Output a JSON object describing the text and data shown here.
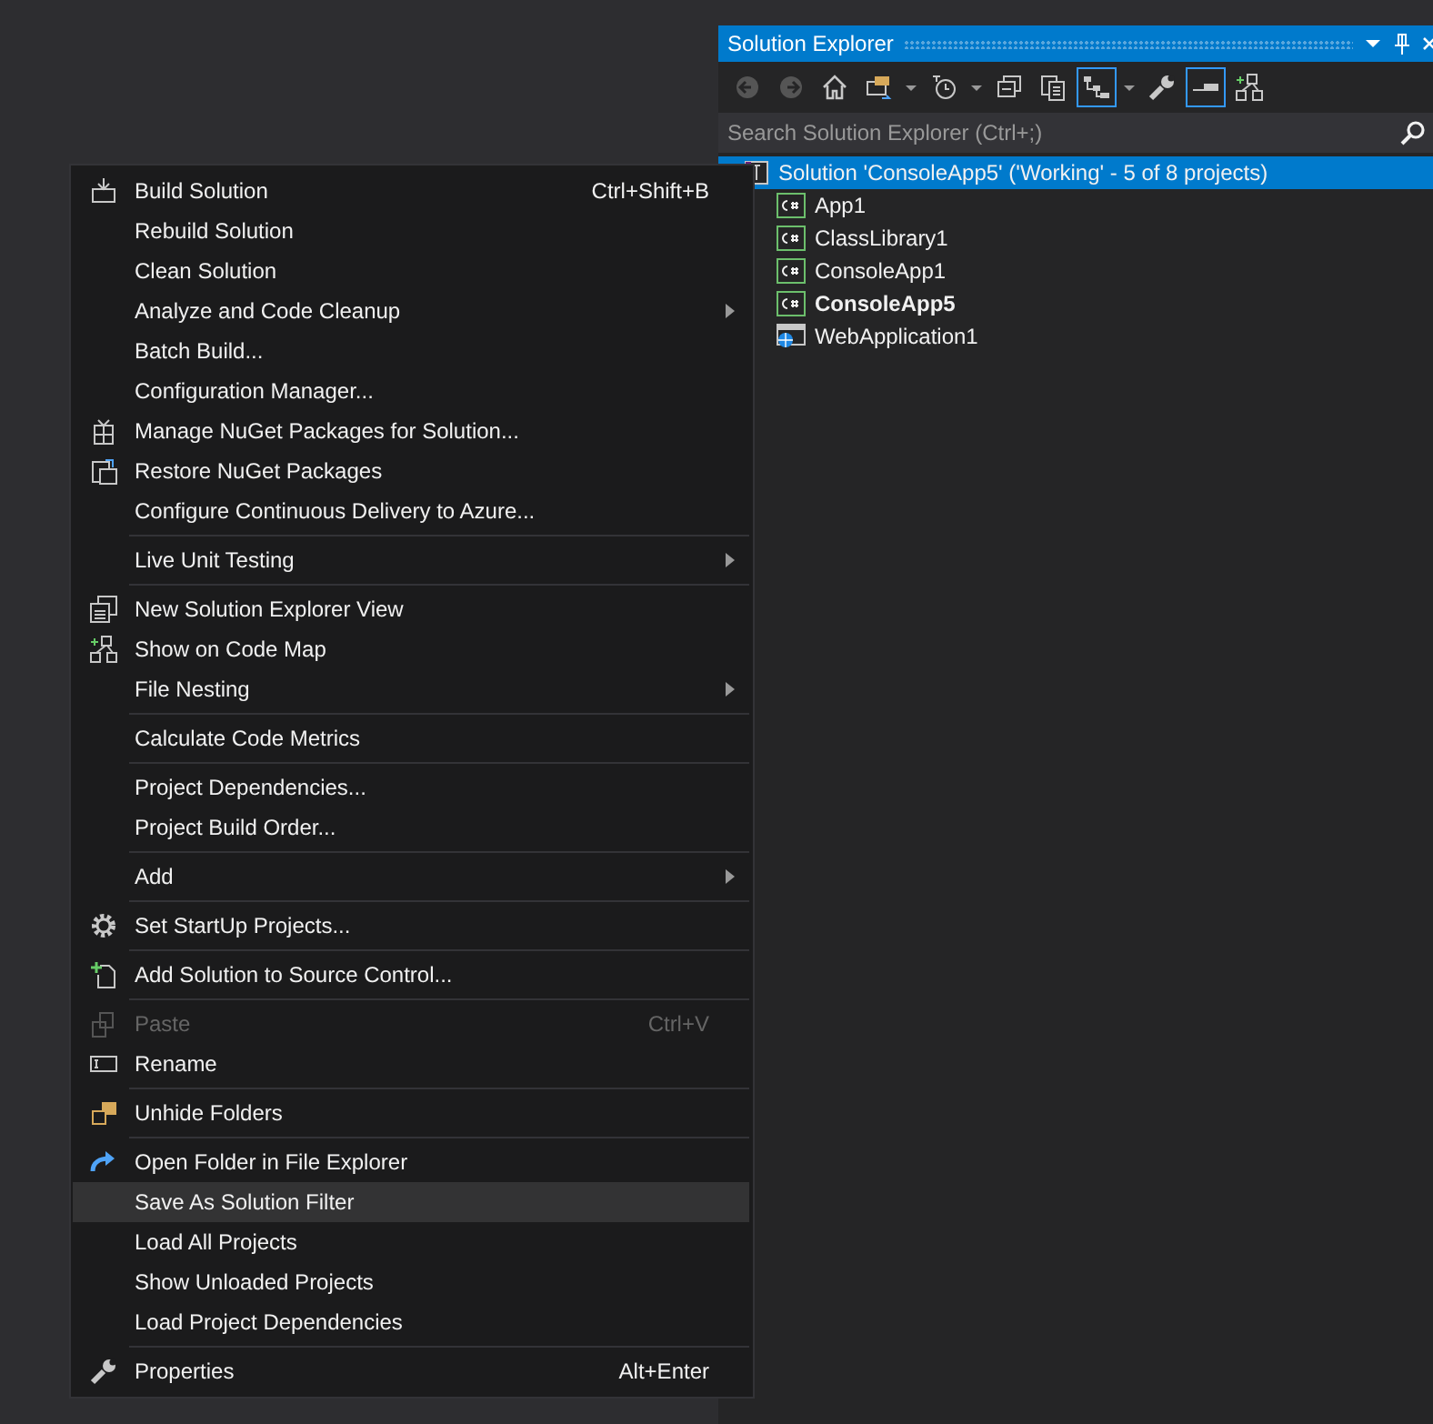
{
  "solution_explorer": {
    "title": "Solution Explorer",
    "toolbar": [
      {
        "kind": "back",
        "disabled": true,
        "active": false
      },
      {
        "kind": "forward",
        "disabled": true,
        "active": false
      },
      {
        "kind": "home",
        "disabled": false,
        "active": false
      },
      {
        "kind": "switch",
        "disabled": false,
        "active": false
      },
      {
        "kind": "dropdown",
        "disabled": false,
        "active": false
      },
      {
        "kind": "history",
        "disabled": false,
        "active": false
      },
      {
        "kind": "dropdown",
        "disabled": false,
        "active": false
      },
      {
        "kind": "collapse",
        "disabled": false,
        "active": false
      },
      {
        "kind": "copy",
        "disabled": false,
        "active": false
      },
      {
        "kind": "sync",
        "disabled": false,
        "active": true
      },
      {
        "kind": "dropdown",
        "disabled": false,
        "active": false
      },
      {
        "kind": "properties",
        "disabled": false,
        "active": false
      },
      {
        "kind": "preview",
        "disabled": false,
        "active": true
      },
      {
        "kind": "codemap",
        "disabled": false,
        "active": false
      }
    ],
    "search": {
      "placeholder": "Search Solution Explorer (Ctrl+;)"
    },
    "tree": [
      {
        "label": "Solution 'ConsoleApp5' ('Working' - 5 of 8 projects)",
        "kind": "solution",
        "selected": true,
        "bold": false,
        "children": [
          {
            "label": "App1",
            "kind": "csharp",
            "selected": false,
            "bold": false
          },
          {
            "label": "ClassLibrary1",
            "kind": "csharp",
            "selected": false,
            "bold": false
          },
          {
            "label": "ConsoleApp1",
            "kind": "csharp",
            "selected": false,
            "bold": false
          },
          {
            "label": "ConsoleApp5",
            "kind": "csharp",
            "selected": false,
            "bold": true
          },
          {
            "label": "WebApplication1",
            "kind": "web",
            "selected": false,
            "bold": false
          }
        ]
      }
    ]
  },
  "context_menu": {
    "groups": [
      [
        {
          "label": "Build Solution",
          "shortcut": "Ctrl+Shift+B",
          "submenu": false,
          "disabled": false,
          "highlighted": false
        },
        {
          "label": "Rebuild Solution",
          "submenu": false,
          "disabled": false,
          "highlighted": false
        },
        {
          "label": "Clean Solution",
          "submenu": false,
          "disabled": false,
          "highlighted": false
        },
        {
          "label": "Analyze and Code Cleanup",
          "submenu": true,
          "disabled": false,
          "highlighted": false
        },
        {
          "label": "Batch Build...",
          "submenu": false,
          "disabled": false,
          "highlighted": false
        },
        {
          "label": "Configuration Manager...",
          "submenu": false,
          "disabled": false,
          "highlighted": false
        },
        {
          "label": "Manage NuGet Packages for Solution...",
          "submenu": false,
          "disabled": false,
          "highlighted": false
        },
        {
          "label": "Restore NuGet Packages",
          "submenu": false,
          "disabled": false,
          "highlighted": false
        },
        {
          "label": "Configure Continuous Delivery to Azure...",
          "submenu": false,
          "disabled": false,
          "highlighted": false
        }
      ],
      [
        {
          "label": "Live Unit Testing",
          "submenu": true,
          "disabled": false,
          "highlighted": false
        }
      ],
      [
        {
          "label": "New Solution Explorer View",
          "submenu": false,
          "disabled": false,
          "highlighted": false
        },
        {
          "label": "Show on Code Map",
          "submenu": false,
          "disabled": false,
          "highlighted": false
        },
        {
          "label": "File Nesting",
          "submenu": true,
          "disabled": false,
          "highlighted": false
        }
      ],
      [
        {
          "label": "Calculate Code Metrics",
          "submenu": false,
          "disabled": false,
          "highlighted": false
        }
      ],
      [
        {
          "label": "Project Dependencies...",
          "submenu": false,
          "disabled": false,
          "highlighted": false
        },
        {
          "label": "Project Build Order...",
          "submenu": false,
          "disabled": false,
          "highlighted": false
        }
      ],
      [
        {
          "label": "Add",
          "submenu": true,
          "disabled": false,
          "highlighted": false
        }
      ],
      [
        {
          "label": "Set StartUp Projects...",
          "submenu": false,
          "disabled": false,
          "highlighted": false
        }
      ],
      [
        {
          "label": "Add Solution to Source Control...",
          "submenu": false,
          "disabled": false,
          "highlighted": false
        }
      ],
      [
        {
          "label": "Paste",
          "shortcut": "Ctrl+V",
          "submenu": false,
          "disabled": true,
          "highlighted": false
        },
        {
          "label": "Rename",
          "submenu": false,
          "disabled": false,
          "highlighted": false
        }
      ],
      [
        {
          "label": "Unhide Folders",
          "submenu": false,
          "disabled": false,
          "highlighted": false
        }
      ],
      [
        {
          "label": "Open Folder in File Explorer",
          "submenu": false,
          "disabled": false,
          "highlighted": false
        },
        {
          "label": "Save As Solution Filter",
          "submenu": false,
          "disabled": false,
          "highlighted": true
        },
        {
          "label": "Load All Projects",
          "submenu": false,
          "disabled": false,
          "highlighted": false
        },
        {
          "label": "Show Unloaded Projects",
          "submenu": false,
          "disabled": false,
          "highlighted": false
        },
        {
          "label": "Load Project Dependencies",
          "submenu": false,
          "disabled": false,
          "highlighted": false
        }
      ],
      [
        {
          "label": "Properties",
          "shortcut": "Alt+Enter",
          "submenu": false,
          "disabled": false,
          "highlighted": false
        }
      ]
    ]
  }
}
